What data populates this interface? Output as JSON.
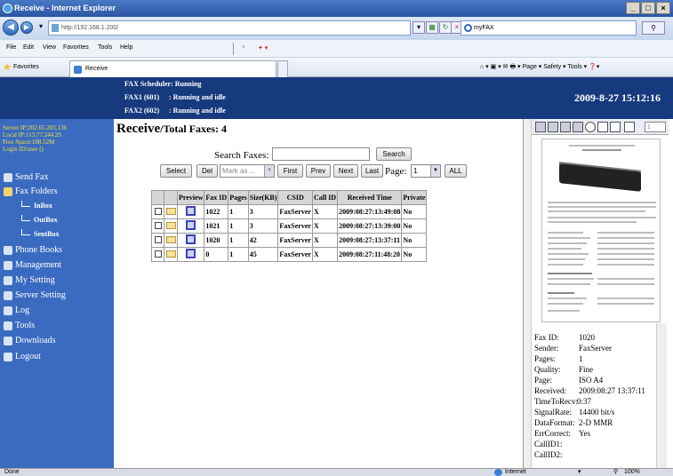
{
  "browser": {
    "window_title": "Receive - Internet Explorer",
    "window_controls": [
      "_",
      "×",
      "×"
    ],
    "address": "http://192.168.1.200/",
    "search_text": "myFAX",
    "menu": [
      "File",
      "Edit",
      "View",
      "Favorites",
      "Tools",
      "Help"
    ],
    "favorites_label": "Favorites",
    "tab_label": "Receive",
    "command_bar": "Page ▾   Safety ▾   Tools ▾",
    "status_left": "Done",
    "status_zone": "Internet",
    "zoom": "100%"
  },
  "header": {
    "rows": [
      {
        "label": "FAX Scheduler: Running",
        "value": ""
      },
      {
        "label": "FAX1 (601)",
        "value": ": Running and idle"
      },
      {
        "label": "FAX2 (602)",
        "value": ": Running and idle"
      }
    ],
    "datetime": "2009-8-27 15:12:16"
  },
  "sidebar": {
    "info": [
      "Server IP:202.65.203.136",
      "Local IP:113.77.244.29",
      "Free Space:188.52M",
      "Login ID:user ()"
    ],
    "items": [
      {
        "label": "Send Fax",
        "icon": "send-fax-icon"
      },
      {
        "label": "Fax Folders",
        "icon": "folder-icon"
      },
      {
        "label": "Phone Books",
        "icon": "phone-book-icon"
      },
      {
        "label": "Management",
        "icon": "management-icon"
      },
      {
        "label": "My Setting",
        "icon": "my-setting-icon"
      },
      {
        "label": "Server Setting",
        "icon": "server-setting-icon"
      },
      {
        "label": "Log",
        "icon": "log-icon"
      },
      {
        "label": "Tools",
        "icon": "tools-icon"
      },
      {
        "label": "Downloads",
        "icon": "downloads-icon"
      },
      {
        "label": "Logout",
        "icon": "logout-icon"
      }
    ],
    "folders": [
      "InBox",
      "OutBox",
      "SentBox"
    ]
  },
  "main": {
    "title": "Receive",
    "subtitle": "/Total Faxes: 4",
    "search_label": "Search Faxes:",
    "search_value": "",
    "search_button": "Search",
    "toolbar": {
      "select": "Select",
      "del": "Del",
      "mark_as": "Mark as ...",
      "first": "First",
      "prev": "Prev",
      "next": "Next",
      "last": "Last",
      "page_label": "Page:",
      "page_value": "1",
      "all": "ALL"
    },
    "columns": [
      "Preview",
      "Fax ID",
      "Pages",
      "Size(KB)",
      "CSID",
      "Call ID",
      "Received Time",
      "Private"
    ],
    "rows": [
      {
        "fax_id": "1022",
        "pages": "1",
        "size": "3",
        "csid": "FaxServer",
        "call_id": "X",
        "time": "2009:08:27:13:49:08",
        "private": "No"
      },
      {
        "fax_id": "1021",
        "pages": "1",
        "size": "3",
        "csid": "FaxServer",
        "call_id": "X",
        "time": "2009:08:27:13:39:00",
        "private": "No"
      },
      {
        "fax_id": "1020",
        "pages": "1",
        "size": "42",
        "csid": "FaxServer",
        "call_id": "X",
        "time": "2009:08:27:13:37:11",
        "private": "No"
      },
      {
        "fax_id": "0",
        "pages": "1",
        "size": "45",
        "csid": "FaxServer",
        "call_id": "X",
        "time": "2009:08:27:11:48:20",
        "private": "No"
      }
    ]
  },
  "viewer": {
    "page_field": "1",
    "fields": [
      {
        "k": "Fax ID:",
        "v": "1020"
      },
      {
        "k": "Sender:",
        "v": "FaxServer"
      },
      {
        "k": "Pages:",
        "v": "1"
      },
      {
        "k": "Quality:",
        "v": "Fine"
      },
      {
        "k": "Page:",
        "v": "ISO A4"
      },
      {
        "k": "Received:",
        "v": "2009:08:27 13:37:11"
      },
      {
        "k": "TimeToRecv:",
        "v": "0:37"
      },
      {
        "k": "SignalRate:",
        "v": "14400 bit/s"
      },
      {
        "k": "DataFormat:",
        "v": "2-D MMR"
      },
      {
        "k": "ErrCorrect:",
        "v": "Yes"
      },
      {
        "k": "CallID1:",
        "v": ""
      },
      {
        "k": "CallID2:",
        "v": ""
      }
    ]
  }
}
